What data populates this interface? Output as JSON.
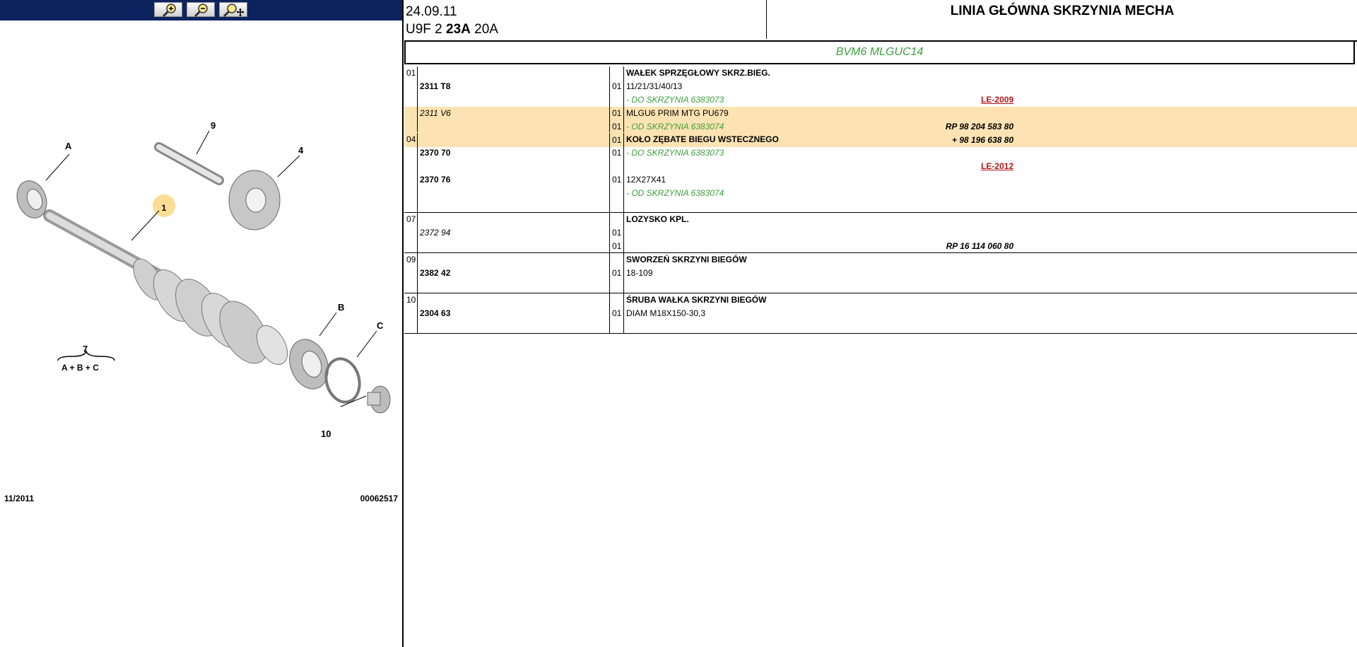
{
  "toolbar": {
    "buttons": [
      {
        "name": "zoom-in-icon"
      },
      {
        "name": "zoom-out-icon"
      },
      {
        "name": "zoom-pan-icon"
      }
    ]
  },
  "diagram": {
    "labels": {
      "a": "A",
      "b": "B",
      "c": "C",
      "one": "1",
      "four": "4",
      "seven": "7",
      "nine": "9",
      "ten": "10",
      "sum": "A + B + C"
    },
    "date": "11/2011",
    "number": "00062517"
  },
  "header": {
    "date": "24.09.11",
    "code_prefix": "U9F 2 ",
    "code_bold": "23A",
    "code_suffix": " 20A",
    "title": "LINIA GŁÓWNA SKRZYNIA MECHA"
  },
  "model": "BVM6 MLGUC14",
  "colors": {
    "highlight": "#fde3b3",
    "green": "#3ca03c",
    "red": "#b31717",
    "navy": "#0c2360"
  },
  "groups": [
    {
      "height": 93,
      "lines": [
        {
          "pos": "01",
          "desc": "WAŁEK SPRZĘGŁOWY SKRZ.BIEG.",
          "desc_style": "title"
        },
        {
          "ref": "2311 T8",
          "qty": "01",
          "desc": "11/21/31/40/13"
        },
        {
          "le": "LE-2009",
          "desc": "- DO SKRZYNIA 6383073",
          "desc_style": "green"
        },
        {
          "ref": "2311 V6",
          "ref_style": "italic",
          "qty": "01",
          "desc": "MLGU6 PRIM MTG PU679",
          "hl": true
        },
        {
          "ident": "RP 98 204 583 80",
          "qty": "01",
          "desc": "- OD SKRZYNIA 6383074",
          "desc_style": "green",
          "hl": true
        },
        {
          "ident": "+ 98 196 638 80",
          "qty": "01",
          "hl": true
        }
      ]
    },
    {
      "height": 112,
      "lines": [
        {
          "pos": "04",
          "desc": "KOŁO ZĘBATE BIEGU WSTECZNEGO",
          "desc_style": "title"
        },
        {
          "ref": "2370 70",
          "qty": "01",
          "desc": "- DO SKRZYNIA 6383073",
          "desc_style": "green"
        },
        {
          "le": "LE-2012"
        },
        {
          "ref": "2370 76",
          "qty": "01",
          "desc": "12X27X41"
        },
        {
          "desc": "- OD SKRZYNIA 6383074",
          "desc_style": "green"
        }
      ]
    },
    {
      "height": 56,
      "lines": [
        {
          "pos": "07",
          "desc": "LOZYSKO KPL.",
          "desc_style": "title"
        },
        {
          "ref": "2372 94",
          "ref_style": "italic",
          "qty": "01"
        },
        {
          "ident": "RP 16 114 060 80",
          "qty": "01"
        }
      ]
    },
    {
      "height": 56,
      "lines": [
        {
          "pos": "09",
          "desc": "SWORZEŃ SKRZYNI BIEGÓW",
          "desc_style": "title"
        },
        {
          "ref": "2382 42",
          "qty": "01",
          "desc": "18-109"
        }
      ]
    },
    {
      "height": 56,
      "lines": [
        {
          "pos": "10",
          "desc": "ŚRUBA WAŁKA SKRZYNI BIEGÓW",
          "desc_style": "title"
        },
        {
          "ref": "2304 63",
          "qty": "01",
          "desc": "DIAM M18X150-30,3"
        }
      ]
    }
  ]
}
